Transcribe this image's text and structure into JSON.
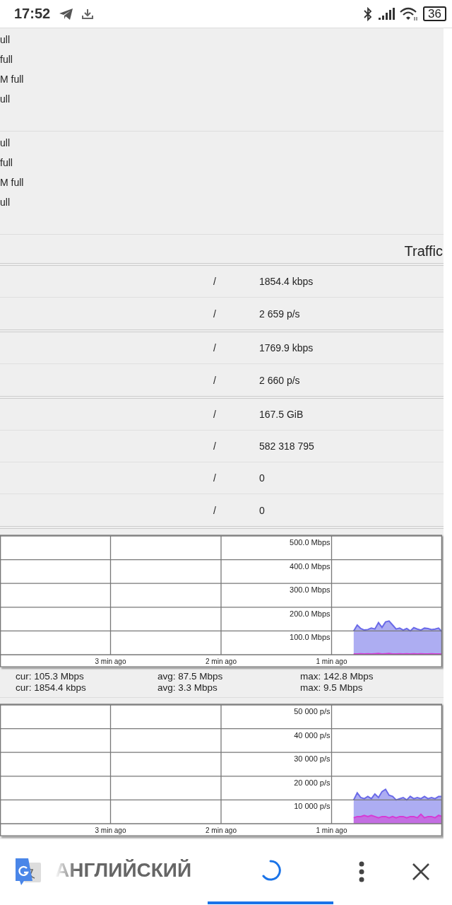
{
  "status_bar": {
    "time": "17:52",
    "battery": "36"
  },
  "memory_groups": [
    {
      "lines": [
        "ull",
        "full",
        "M full",
        "ull"
      ]
    },
    {
      "lines": [
        "ull",
        "full",
        "M full",
        "ull"
      ]
    }
  ],
  "traffic": {
    "title": "Traffic",
    "groups": [
      {
        "rows": [
          {
            "separator": "/",
            "value": "1854.4 kbps"
          },
          {
            "separator": "/",
            "value": "2 659 p/s"
          }
        ]
      },
      {
        "rows": [
          {
            "separator": "/",
            "value": "1769.9 kbps"
          },
          {
            "separator": "/",
            "value": "2 660 p/s"
          }
        ]
      },
      {
        "rows": [
          {
            "separator": "/",
            "value": "167.5 GiB"
          },
          {
            "separator": "/",
            "value": "582 318 795"
          },
          {
            "separator": "/",
            "value": "0"
          },
          {
            "separator": "/",
            "value": "0"
          }
        ]
      }
    ]
  },
  "charts": [
    {
      "chart_data": {
        "type": "area",
        "grid": true,
        "x": [
          -0.8,
          -0.768,
          -0.736,
          -0.704,
          -0.672,
          -0.64,
          -0.608,
          -0.576,
          -0.544,
          -0.512,
          -0.48,
          -0.448,
          -0.416,
          -0.384,
          -0.352,
          -0.32,
          -0.288,
          -0.256,
          -0.224,
          -0.192,
          -0.16,
          -0.128,
          -0.096,
          -0.064,
          -0.032,
          0
        ],
        "xlim": [
          -4,
          0
        ],
        "ylim": [
          0,
          500
        ],
        "xticks": [
          {
            "value": -3,
            "label": "3 min ago"
          },
          {
            "value": -2,
            "label": "2 min ago"
          },
          {
            "value": -1,
            "label": "1 min ago"
          }
        ],
        "yticks": [
          {
            "value": 100,
            "label": "100.0 Mbps"
          },
          {
            "value": 200,
            "label": "200.0 Mbps"
          },
          {
            "value": 300,
            "label": "300.0 Mbps"
          },
          {
            "value": 400,
            "label": "400.0 Mbps"
          },
          {
            "value": 500,
            "label": "500.0 Mbps"
          }
        ],
        "series": [
          {
            "color": "#6a6ae8",
            "values": [
              100,
              125,
              110,
              104,
              106,
              112,
              108,
              135,
              115,
              138,
              142,
              125,
              108,
              112,
              104,
              110,
              100,
              114,
              108,
              104,
              112,
              110,
              106,
              108,
              112,
              96
            ]
          },
          {
            "color": "#d63ad6",
            "values": [
              3,
              3,
              4,
              3,
              4,
              3,
              4,
              5,
              3,
              4,
              5,
              3,
              3,
              4,
              3,
              4,
              3,
              4,
              3,
              4,
              3,
              3,
              4,
              3,
              3,
              3
            ]
          }
        ]
      },
      "stats": [
        {
          "cur": "cur: 105.3 Mbps",
          "avg": "avg: 87.5 Mbps",
          "max": "max: 142.8 Mbps"
        },
        {
          "cur": "cur: 1854.4 kbps",
          "avg": "avg: 3.3 Mbps",
          "max": "max: 9.5 Mbps"
        }
      ]
    },
    {
      "chart_data": {
        "type": "area",
        "grid": true,
        "x": [
          -0.8,
          -0.768,
          -0.736,
          -0.704,
          -0.672,
          -0.64,
          -0.608,
          -0.576,
          -0.544,
          -0.512,
          -0.48,
          -0.448,
          -0.416,
          -0.384,
          -0.352,
          -0.32,
          -0.288,
          -0.256,
          -0.224,
          -0.192,
          -0.16,
          -0.128,
          -0.096,
          -0.064,
          -0.032,
          0
        ],
        "xlim": [
          -4,
          0
        ],
        "ylim": [
          0,
          50000
        ],
        "xticks": [
          {
            "value": -3,
            "label": "3 min ago"
          },
          {
            "value": -2,
            "label": "2 min ago"
          },
          {
            "value": -1,
            "label": "1 min ago"
          }
        ],
        "yticks": [
          {
            "value": 10000,
            "label": "10 000 p/s"
          },
          {
            "value": 20000,
            "label": "20 000 p/s"
          },
          {
            "value": 30000,
            "label": "30 000 p/s"
          },
          {
            "value": 40000,
            "label": "40 000 p/s"
          },
          {
            "value": 50000,
            "label": "50 000 p/s"
          }
        ],
        "series": [
          {
            "color": "#6a6ae8",
            "values": [
              10000,
              13000,
              11000,
              10500,
              11500,
              10500,
              12500,
              11000,
              13500,
              14500,
              12000,
              11500,
              10000,
              10500,
              11000,
              10000,
              11500,
              10500,
              11000,
              10500,
              11500,
              10500,
              11000,
              10500,
              11500,
              11500
            ]
          },
          {
            "color": "#d63ad6",
            "values": [
              2500,
              3000,
              3000,
              3500,
              3000,
              3500,
              3000,
              2500,
              3000,
              3000,
              2500,
              3000,
              2500,
              3000,
              3000,
              2500,
              3000,
              3000,
              2500,
              4000,
              2500,
              3000,
              3000,
              2500,
              3500,
              3000
            ]
          }
        ]
      }
    }
  ],
  "translate_bar": {
    "tabs": [
      {
        "kind": "text",
        "label": "АНГЛИЙСКИЙ",
        "selected": false
      },
      {
        "kind": "spinner",
        "selected": true
      }
    ]
  }
}
